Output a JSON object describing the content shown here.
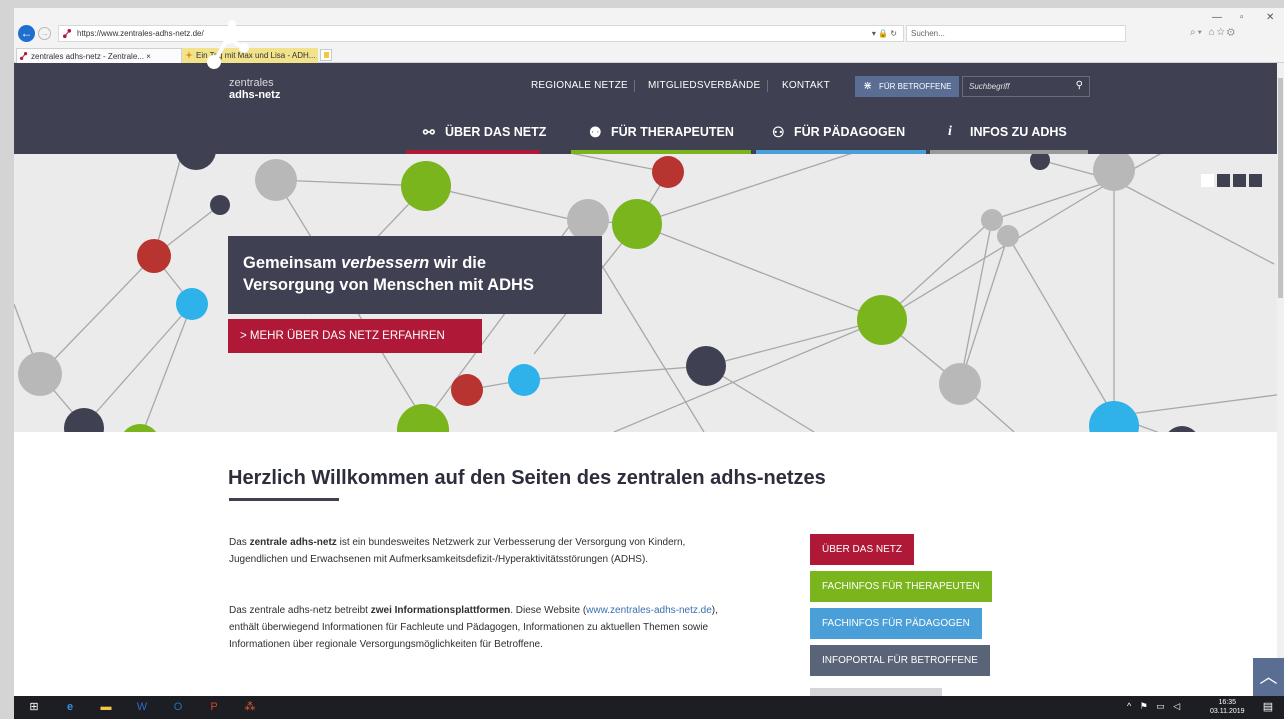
{
  "browser": {
    "url": "https://www.zentrales-adhs-netz.de/",
    "search_placeholder": "Suchen...",
    "tabs": [
      {
        "label": "zentrales adhs-netz - Zentrale... ×"
      },
      {
        "label": "Ein Tag mit Max und Lisa - ADH..."
      }
    ]
  },
  "site": {
    "logo": {
      "line1": "zentrales",
      "line2": "adhs-netz"
    },
    "topnav": [
      "REGIONALE NETZE",
      "MITGLIEDSVERBÄNDE",
      "KONTAKT"
    ],
    "betroffene_button": "FÜR BETROFFENE",
    "search_placeholder": "Suchbegriff",
    "mainnav": [
      {
        "label": "ÜBER DAS NETZ",
        "icon": "network-icon",
        "color": "#b01838"
      },
      {
        "label": "FÜR THERAPEUTEN",
        "icon": "people-icon",
        "color": "#7ab51d"
      },
      {
        "label": "FÜR PÄDAGOGEN",
        "icon": "group-icon",
        "color": "#4a9fd8"
      },
      {
        "label": "INFOS ZU ADHS",
        "icon": "info-icon",
        "color": "#9a9a9a"
      }
    ]
  },
  "hero": {
    "headline_part1": "Gemeinsam",
    "headline_em": "verbessern",
    "headline_part2": "wir die",
    "headline_line2": "Versorgung von Menschen mit ADHS",
    "cta": "> MEHR ÜBER DAS NETZ ERFAHREN"
  },
  "content": {
    "heading": "Herzlich Willkommen auf den Seiten des zentralen adhs-netzes",
    "para1": {
      "pre": "Das ",
      "bold": "zentrale adhs-netz",
      "post": " ist ein bundesweites Netzwerk zur Verbesserung der Versorgung von Kindern, Jugendlichen und Erwachsenen mit Aufmerksamkeitsdefizit-/Hyperaktivitätsstörungen (ADHS)."
    },
    "para2": {
      "pre": "Das zentrale adhs-netz betreibt ",
      "bold": "zwei Informationsplattformen",
      "mid": ". Diese Website (",
      "link": "www.zentrales-adhs-netz.de",
      "post": "), enthält überwiegend Informationen für Fachleute und Pädagogen, Informationen zu aktuellen Themen sowie Informationen über regionale Versorgungsmöglichkeiten für Betroffene."
    },
    "side_buttons": [
      {
        "label": "ÜBER DAS NETZ",
        "color": "#b01838"
      },
      {
        "label": "FACHINFOS FÜR THERAPEUTEN",
        "color": "#7ab51d"
      },
      {
        "label": "FACHINFOS FÜR PÄDAGOGEN",
        "color": "#4a9fd8"
      },
      {
        "label": "INFOPORTAL FÜR BETROFFENE",
        "color": "#5a6478"
      }
    ]
  },
  "taskbar": {
    "time": "16:35",
    "date": "03.11.2019"
  }
}
